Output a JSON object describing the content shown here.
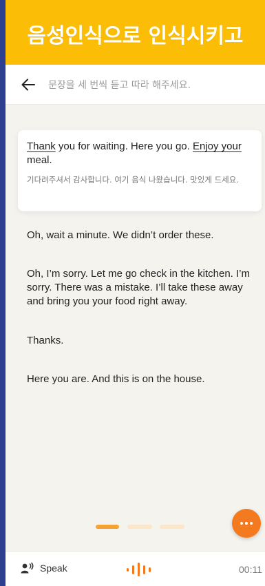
{
  "banner": {
    "title": "음성인식으로 인식시키고"
  },
  "topbar": {
    "instruction": "문장을 세 번씩 듣고 따라 해주세요."
  },
  "dialogue": {
    "active": {
      "en_parts": [
        "Thank",
        " you for waiting. Here you go. ",
        "Enjoy your",
        " meal."
      ],
      "ko": "기다려주셔서 감사합니다. 여기 음식 나왔습니다. 맛있게 드세요."
    },
    "lines": [
      "Oh, wait a minute. We didn’t order these.",
      "Oh, I’m sorry. Let me go check in the kitchen. I’m sorry. There was a mistake. I’ll take these away and bring you your food right away.",
      "Thanks.",
      "Here you are. And this is on the house."
    ]
  },
  "pager": {
    "count": 3,
    "current": 1
  },
  "bottombar": {
    "speak_label": "Speak",
    "timer": "00:11"
  },
  "colors": {
    "banner": "#fbbd05",
    "accent": "#f47a1f",
    "frame_border": "#2f3f8f",
    "pager_inactive": "#fbe6c9"
  },
  "icons": {
    "back": "arrow-left-icon",
    "more": "more-dots-icon",
    "speak": "speaker-voice-icon",
    "wave": "audio-wave-icon"
  }
}
